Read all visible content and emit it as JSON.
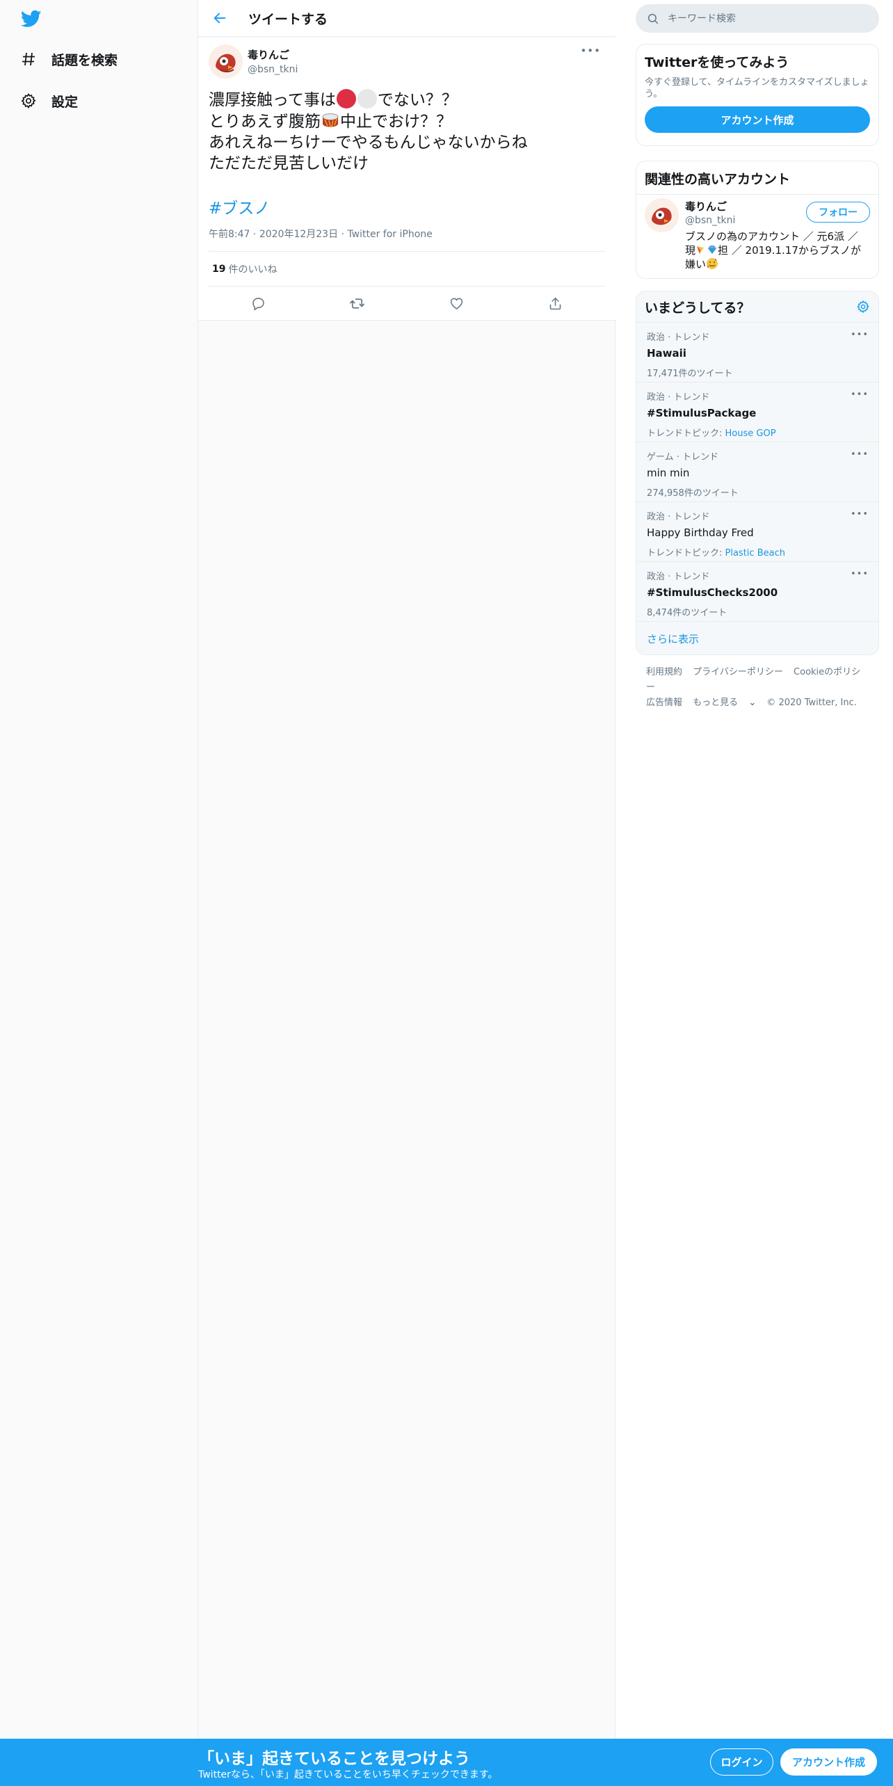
{
  "nav": {
    "items": [
      {
        "label": "話題を検索",
        "icon": "hashtag-icon"
      },
      {
        "label": "設定",
        "icon": "gear-icon"
      }
    ]
  },
  "header": {
    "title": "ツイートする"
  },
  "tweet": {
    "author_name": "毒りんご",
    "author_handle": "@bsn_tkni",
    "line1_a": "濃厚接触って事は",
    "line1_b": "でない？？",
    "line2_a": "とりあえず腹筋",
    "line2_b": "中止でおけ？？",
    "line3": "あれえねーちけーでやるもんじゃないからね",
    "line4": "ただただ見苦しいだけ",
    "hashtag": "#ブスノ",
    "time": "午前8:47",
    "date": "2020年12月23日",
    "source": "Twitter for iPhone",
    "likes_count": "19",
    "likes_label": "件のいいね"
  },
  "search": {
    "placeholder": "キーワード検索"
  },
  "signup_card": {
    "title": "Twitterを使ってみよう",
    "subtitle": "今すぐ登録して、タイムラインをカスタマイズしましょう。",
    "button": "アカウント作成"
  },
  "related": {
    "title": "関連性の高いアカウント",
    "name": "毒りんご",
    "handle": "@bsn_tkni",
    "bio_line1": "ブスノの為のアカウント ／ 元6派 ／",
    "bio_line2_a": "現",
    "bio_line2_b": "担 ／ 2019.1.17からブスノが",
    "bio_line3": "嫌い",
    "follow": "フォロー"
  },
  "trends": {
    "title": "いまどうしてる？",
    "items": [
      {
        "category": "政治 · トレンド",
        "name": "Hawaii",
        "foot": "17,471件のツイート",
        "topic": ""
      },
      {
        "category": "政治 · トレンド",
        "name": "#StimulusPackage",
        "foot": "トレンドトピック: ",
        "topic": "House GOP"
      },
      {
        "category": "ゲーム · トレンド",
        "name": "min min",
        "foot": "274,958件のツイート",
        "topic": ""
      },
      {
        "category": "政治 · トレンド",
        "name": "Happy Birthday Fred",
        "foot": "トレンドトピック: ",
        "topic": "Plastic Beach"
      },
      {
        "category": "政治 · トレンド",
        "name": "#StimulusChecks2000",
        "foot": "8,474件のツイート",
        "topic": ""
      }
    ],
    "show_more": "さらに表示"
  },
  "footer": {
    "links": [
      "利用規約",
      "プライバシーポリシー",
      "Cookieのポリシー",
      "広告情報",
      "もっと見る"
    ],
    "copyright": "© 2020 Twitter, Inc."
  },
  "bottom_bar": {
    "title": "「いま」起きていることを見つけよう",
    "subtitle": "Twitterなら、「いま」起きていることをいち早くチェックできます。",
    "login": "ログイン",
    "signup": "アカウント作成"
  },
  "colors": {
    "accent": "#1da1f2",
    "link": "#1b95e0",
    "muted": "#657786"
  }
}
